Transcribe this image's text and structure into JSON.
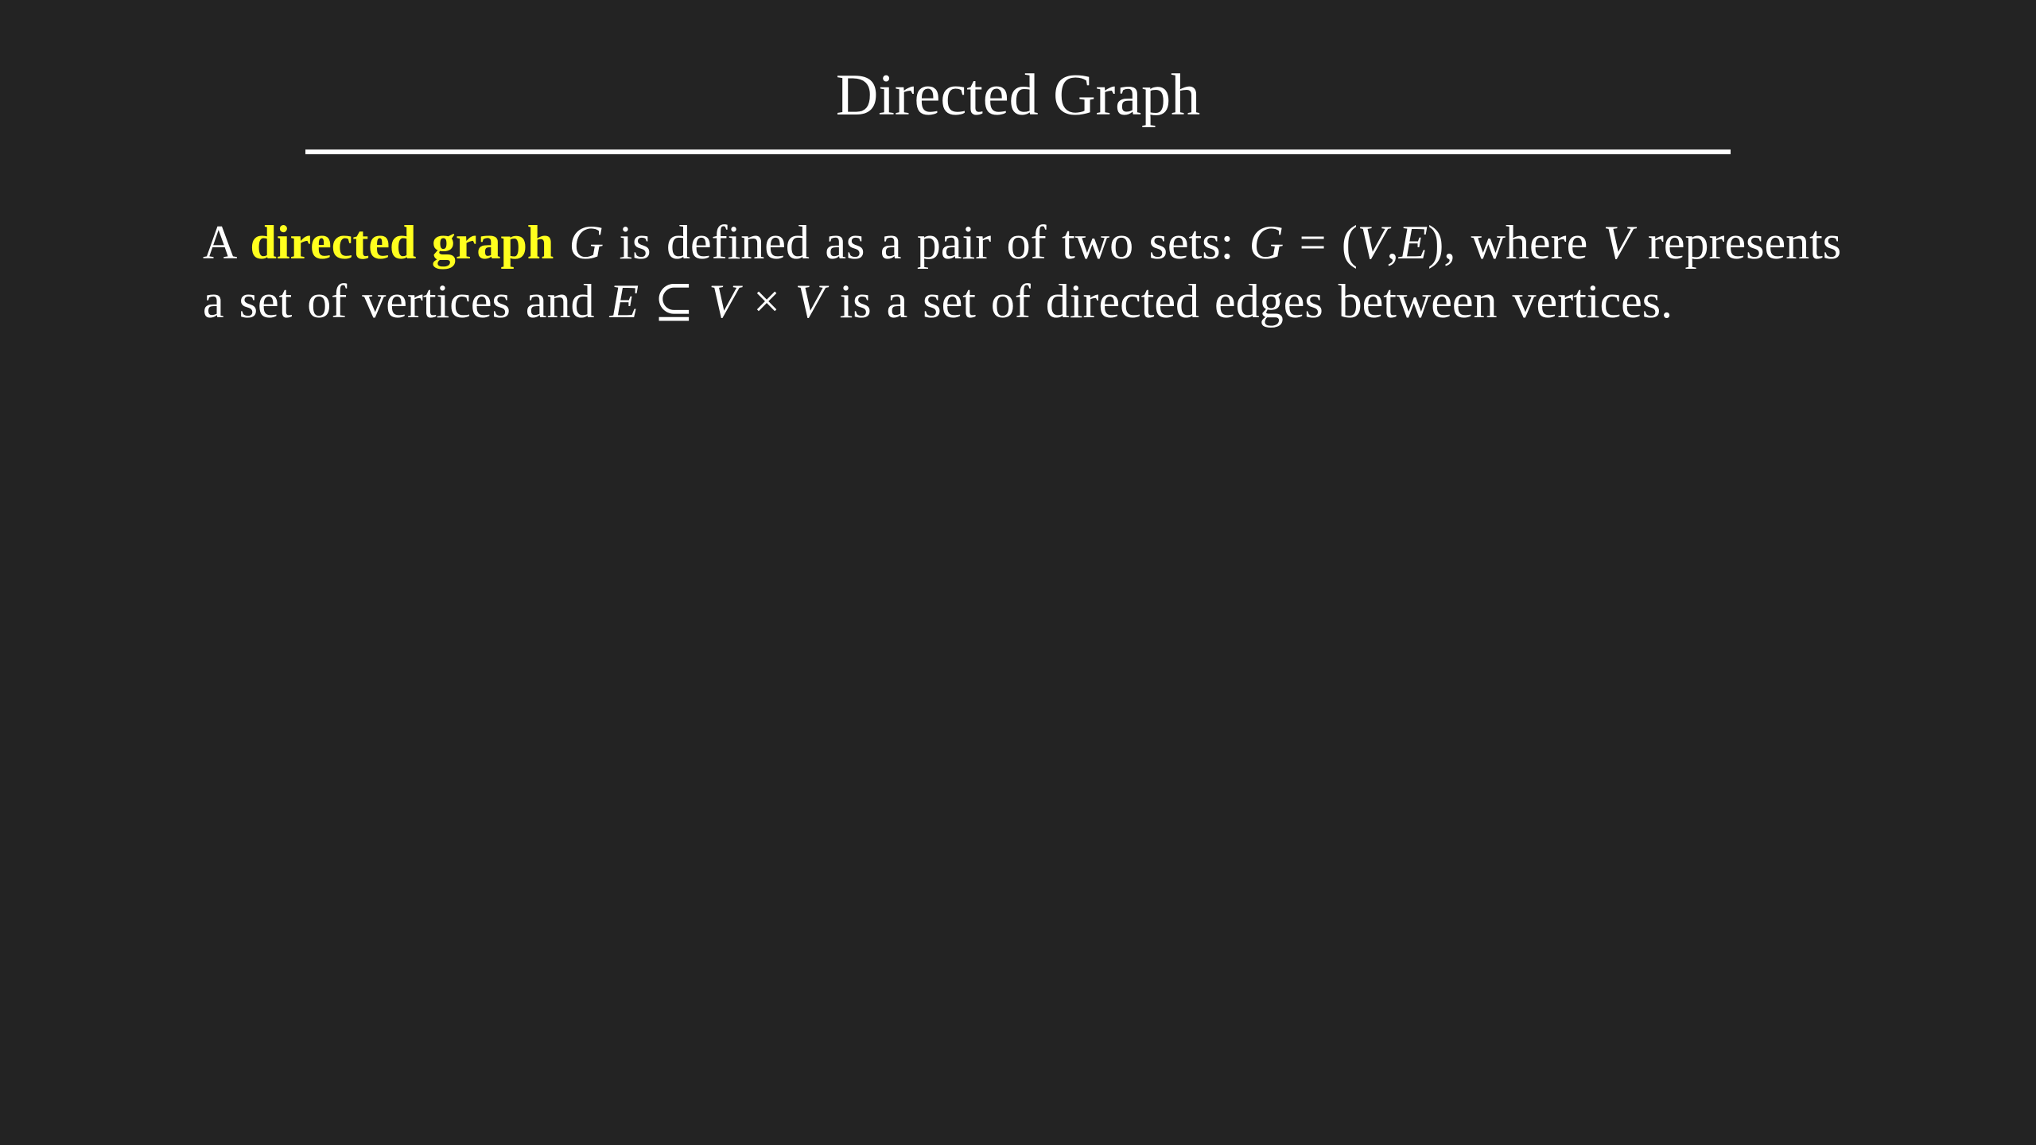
{
  "slide": {
    "title": "Directed Graph",
    "highlight_color": "#ffff1e",
    "background_color": "#232323",
    "definition": {
      "t1": "A",
      "term": "directed graph",
      "m1": "G",
      "t2": "is defined as a pair of two sets:",
      "m2": "G",
      "op_eq": "=",
      "paren_open": "(",
      "m3": "V",
      "comma": ",",
      "m4": "E",
      "paren_close": ")",
      "t3": ", where",
      "m5": "V",
      "t4": "represents a set of vertices and",
      "m6": "E",
      "op_subseteq": "⊆",
      "m7": "V",
      "op_times": "×",
      "m8": "V",
      "t5": "is a set of directed edges between vertices."
    }
  }
}
